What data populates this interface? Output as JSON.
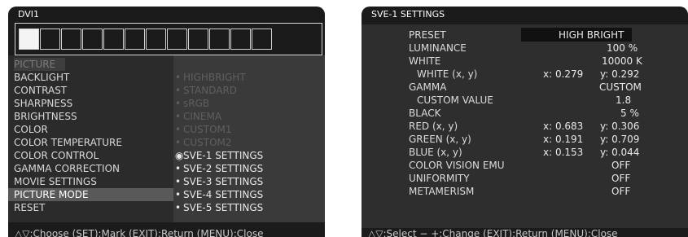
{
  "left": {
    "title": "DVI1",
    "menu": [
      {
        "label": "PICTURE",
        "state": "section"
      },
      {
        "label": "BACKLIGHT"
      },
      {
        "label": "CONTRAST"
      },
      {
        "label": "SHARPNESS"
      },
      {
        "label": "BRIGHTNESS"
      },
      {
        "label": "COLOR"
      },
      {
        "label": "COLOR TEMPERATURE"
      },
      {
        "label": "COLOR CONTROL"
      },
      {
        "label": "GAMMA CORRECTION"
      },
      {
        "label": "MOVIE SETTINGS"
      },
      {
        "label": "PICTURE MODE",
        "state": "selected"
      },
      {
        "label": "RESET"
      }
    ],
    "submenu": [
      {
        "label": "HIGHBRIGHT",
        "state": "disabled"
      },
      {
        "label": "STANDARD",
        "state": "disabled"
      },
      {
        "label": "sRGB",
        "state": "disabled"
      },
      {
        "label": "CINEMA",
        "state": "disabled"
      },
      {
        "label": "CUSTOM1",
        "state": "disabled"
      },
      {
        "label": "CUSTOM2",
        "state": "disabled"
      },
      {
        "label": "SVE-1 SETTINGS",
        "state": "selected"
      },
      {
        "label": "SVE-2 SETTINGS"
      },
      {
        "label": "SVE-3 SETTINGS"
      },
      {
        "label": "SVE-4 SETTINGS"
      },
      {
        "label": "SVE-5 SETTINGS"
      }
    ],
    "footer": "△▽:Choose (SET):Mark (EXIT):Return (MENU):Close"
  },
  "right": {
    "title": "SVE-1 SETTINGS",
    "rows": [
      {
        "label": "PRESET",
        "value": "HIGH BRIGHT"
      },
      {
        "label": "LUMINANCE",
        "value": "100 %"
      },
      {
        "label": "WHITE",
        "value": "10000  K"
      },
      {
        "label": "WHITE (x, y)",
        "x": "x: 0.279",
        "y": "y: 0.292"
      },
      {
        "label": "GAMMA",
        "value": "CUSTOM"
      },
      {
        "label": "CUSTOM VALUE",
        "value": "1.8"
      },
      {
        "label": "BLACK",
        "value": "5 %"
      },
      {
        "label": "RED (x, y)",
        "x": "x: 0.683",
        "y": "y: 0.306"
      },
      {
        "label": "GREEN (x, y)",
        "x": "x: 0.191",
        "y": "y: 0.709"
      },
      {
        "label": "BLUE (x, y)",
        "x": "x: 0.153",
        "y": "y: 0.044"
      },
      {
        "label": "COLOR VISION EMU",
        "value": "OFF"
      },
      {
        "label": "UNIFORMITY",
        "value": "OFF"
      },
      {
        "label": "METAMERISM",
        "value": "OFF"
      }
    ],
    "footer": "△▽:Select  − +:Change (EXIT):Return (MENU):Close"
  }
}
